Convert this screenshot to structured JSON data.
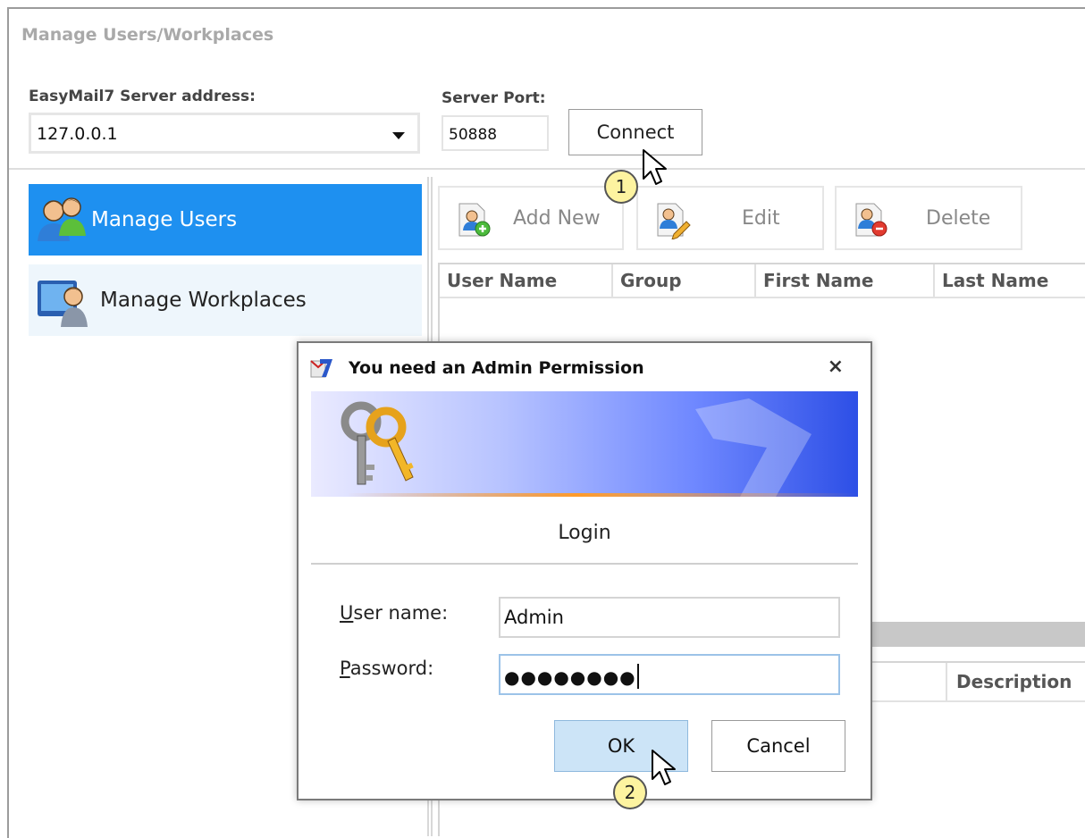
{
  "window": {
    "title": "Manage Users/Workplaces"
  },
  "server": {
    "address_label": "EasyMail7 Server address:",
    "address_value": "127.0.0.1",
    "port_label": "Server Port:",
    "port_value": "50888",
    "connect_label": "Connect"
  },
  "sidebar": {
    "items": [
      {
        "label": "Manage Users",
        "icon": "users-icon",
        "selected": true
      },
      {
        "label": "Manage Workplaces",
        "icon": "workplace-icon",
        "selected": false
      }
    ]
  },
  "toolbar": {
    "add_label": "Add New",
    "edit_label": "Edit",
    "delete_label": "Delete"
  },
  "users_table": {
    "columns": [
      "User Name",
      "Group",
      "First Name",
      "Last Name"
    ]
  },
  "second_table": {
    "columns": [
      "Description"
    ]
  },
  "dialog": {
    "title": "You need an Admin Permission",
    "close": "×",
    "section_label": "Login",
    "username_label_first": "U",
    "username_label_rest": "ser name:",
    "username_value": "Admin",
    "password_label_first": "P",
    "password_label_rest": "assword:",
    "password_value": "●●●●●●●●",
    "ok_label": "OK",
    "cancel_label": "Cancel"
  },
  "annotations": {
    "step1": "1",
    "step2": "2"
  },
  "colors": {
    "selected_nav": "#1e90f0",
    "nav_hover": "#eef6fc",
    "ok_button": "#cce4f7",
    "badge": "#fdf3a0"
  }
}
